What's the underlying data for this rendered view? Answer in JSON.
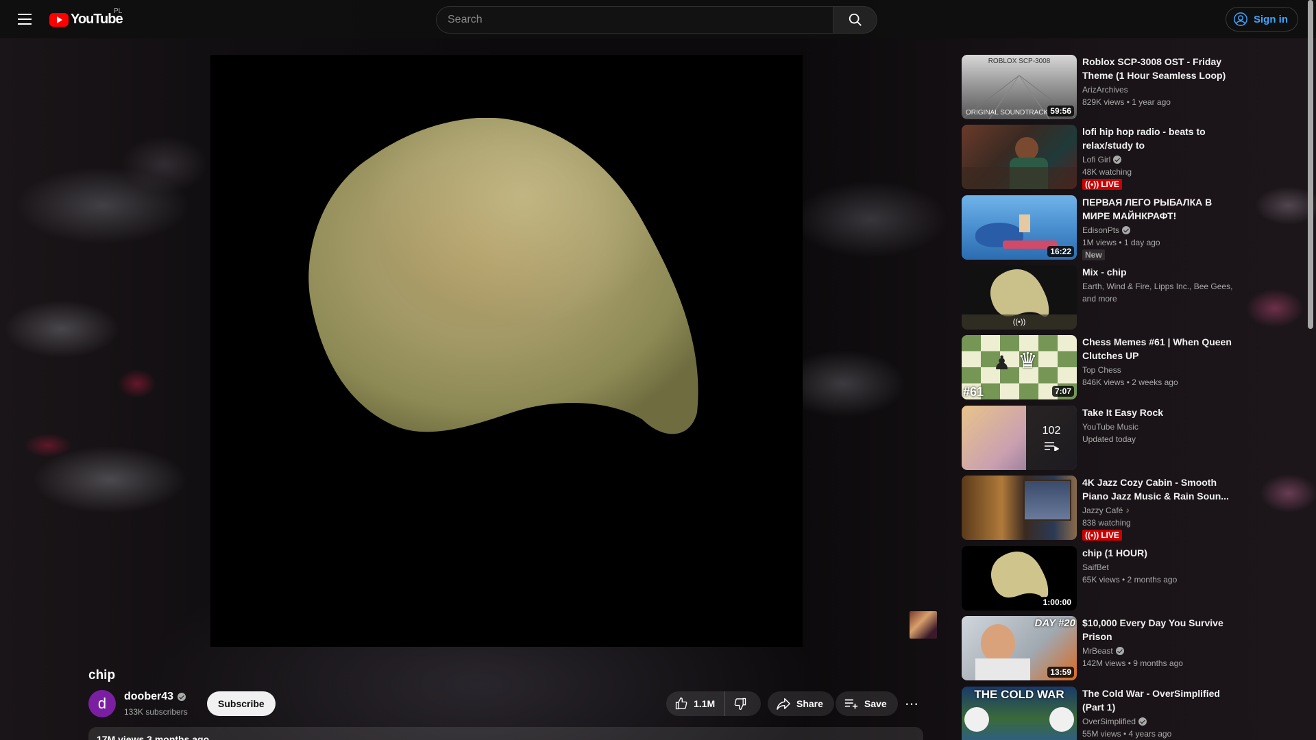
{
  "header": {
    "logo_text": "YouTube",
    "country_code": "PL",
    "search_placeholder": "Search",
    "sign_in_label": "Sign in"
  },
  "video": {
    "title": "chip",
    "channel": {
      "avatar_letter": "d",
      "name": "doober43",
      "subscribers": "133K subscribers"
    },
    "subscribe_label": "Subscribe",
    "likes": "1.1M",
    "share_label": "Share",
    "save_label": "Save",
    "description_preview": "17M views  3 months ago"
  },
  "recommendations": [
    {
      "title": "Roblox SCP-3008 OST - Friday Theme (1 Hour Seamless Loop)",
      "channel": "ArizArchives",
      "verified": false,
      "meta": "829K views  • 1 year ago",
      "duration": "59:56",
      "thumb_text_top": "ROBLOX SCP-3008",
      "thumb_text_bottom": "ORIGINAL SOUNDTRACK"
    },
    {
      "title": "lofi hip hop radio - beats to relax/study to",
      "channel": "Lofi Girl",
      "verified": true,
      "meta": "48K watching",
      "badge": "LIVE"
    },
    {
      "title": "ПЕРВАЯ ЛЕГО РЫБАЛКА В МИРЕ МАЙНКРАФТ!",
      "channel": "EdisonPts",
      "verified": true,
      "meta": "1M views  • 1 day ago",
      "duration": "16:22",
      "badge": "New"
    },
    {
      "title": "Mix - chip",
      "channel": "Earth, Wind & Fire, Lipps Inc., Bee Gees, and more",
      "verified": false,
      "meta": ""
    },
    {
      "title": "Chess Memes #61 | When Queen Clutches UP",
      "channel": "Top Chess",
      "verified": false,
      "meta": "846K views  • 2 weeks ago",
      "duration": "7:07",
      "thumb_text": "#61"
    },
    {
      "title": "Take It Easy Rock",
      "channel": "YouTube Music",
      "verified": false,
      "meta": "Updated today",
      "playlist_count": "102"
    },
    {
      "title": "4K Jazz Cozy Cabin - Smooth Piano Jazz Music & Rain Soun...",
      "channel": "Jazzy Café",
      "verified": false,
      "music_note": true,
      "meta": "838 watching",
      "badge": "LIVE"
    },
    {
      "title": "chip (1 HOUR)",
      "channel": "SaifBet",
      "verified": false,
      "meta": "65K views  • 2 months ago",
      "duration": "1:00:00"
    },
    {
      "title": "$10,000 Every Day You Survive Prison",
      "channel": "MrBeast",
      "verified": true,
      "meta": "142M views  • 9 months ago",
      "duration": "13:59",
      "thumb_text": "DAY #20"
    },
    {
      "title": "The Cold War - OverSimplified (Part 1)",
      "channel": "OverSimplified",
      "verified": true,
      "meta": "55M views  • 4 years ago",
      "thumb_text": "THE COLD WAR"
    }
  ],
  "colors": {
    "accent_red": "#ff0000",
    "link_blue": "#3ea6ff",
    "live_red": "#cc0000"
  }
}
